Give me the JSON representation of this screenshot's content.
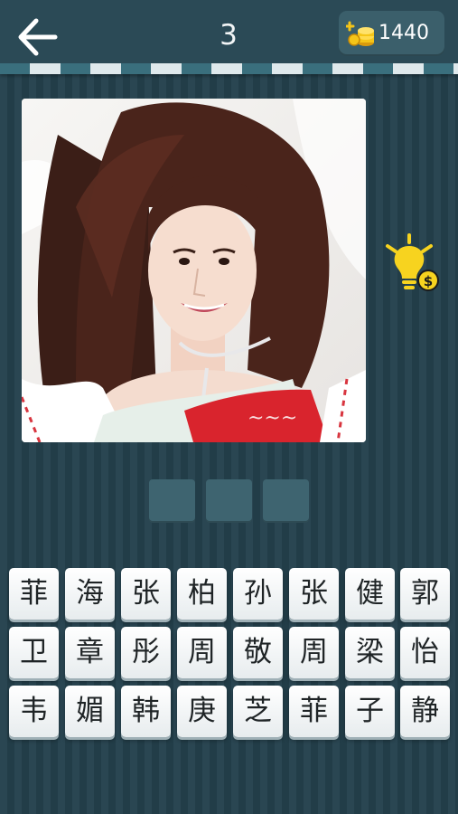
{
  "header": {
    "level": "3",
    "coins": "1440",
    "icons": {
      "back": "left-arrow-icon",
      "coins": "coin-stack-plus-icon"
    }
  },
  "hint": {
    "icon": "lightbulb-dollar-icon"
  },
  "answer_slots": [
    "",
    "",
    ""
  ],
  "letter_tiles": [
    [
      "菲",
      "海",
      "张",
      "柏",
      "孙",
      "张",
      "健",
      "郭"
    ],
    [
      "卫",
      "章",
      "彤",
      "周",
      "敬",
      "周",
      "梁",
      "怡"
    ],
    [
      "韦",
      "媚",
      "韩",
      "庚",
      "芝",
      "菲",
      "子",
      "静"
    ]
  ],
  "colors": {
    "background": "#26424d",
    "topbar": "#2b4a56",
    "coin_gold": "#f5c518",
    "hint_yellow": "#f7d31f",
    "tile_face": "#ffffff",
    "slot": "#3e6470"
  }
}
